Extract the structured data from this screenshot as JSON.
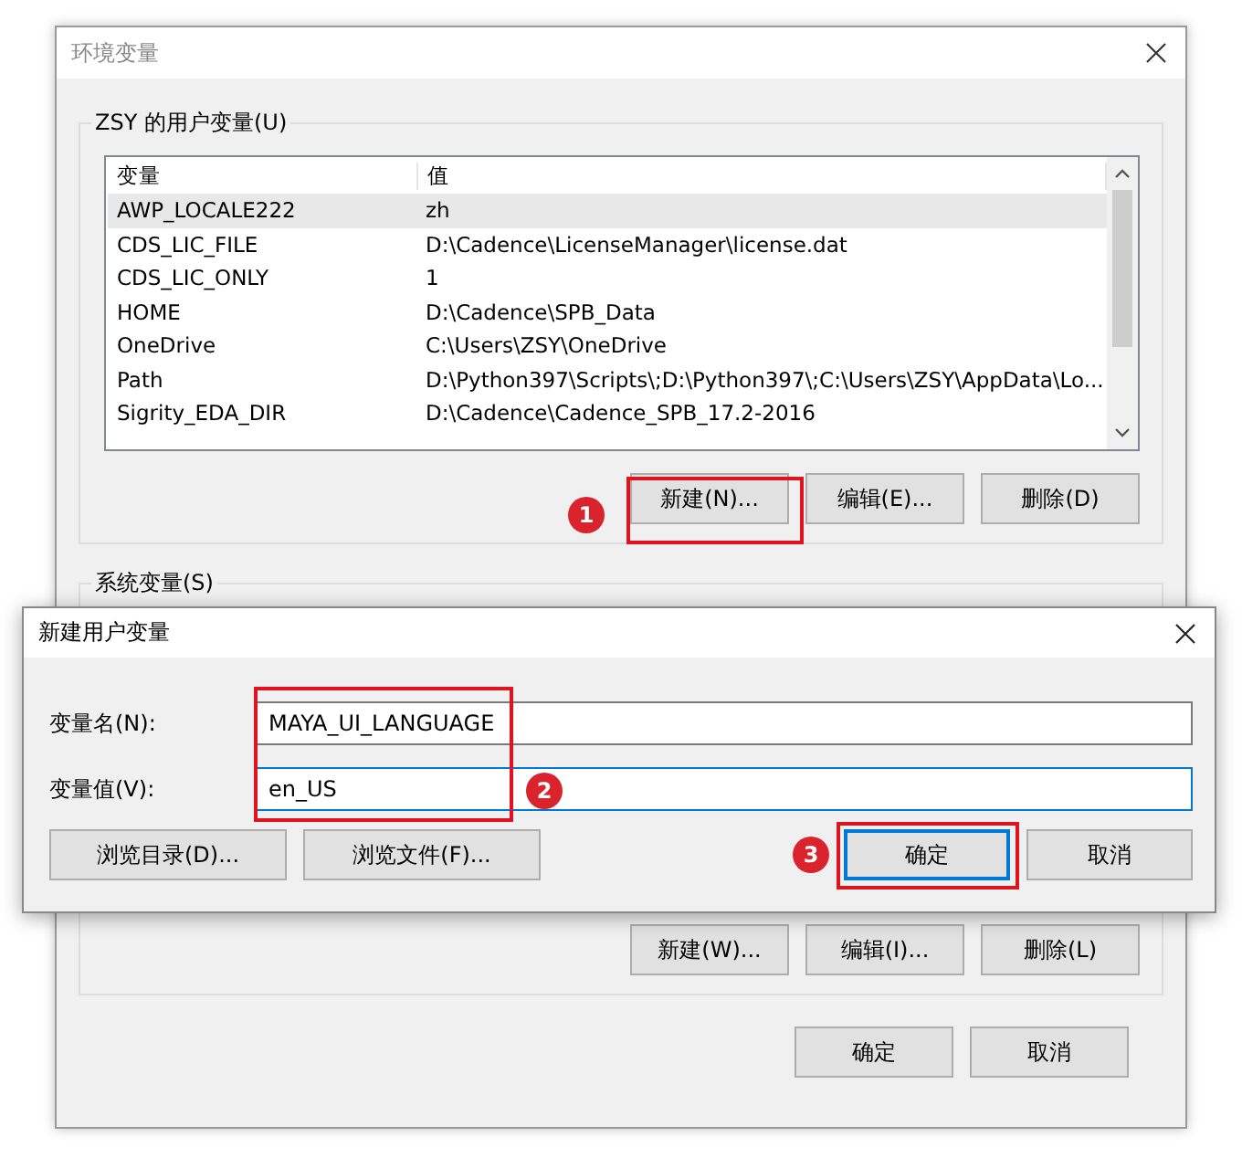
{
  "dialog": {
    "title": "环境变量"
  },
  "user_variables": {
    "label": "ZSY 的用户变量(U)",
    "columns": [
      "变量",
      "值"
    ],
    "rows": [
      {
        "name": "AWP_LOCALE222",
        "value": "zh",
        "selected": true
      },
      {
        "name": "CDS_LIC_FILE",
        "value": "D:\\Cadence\\LicenseManager\\license.dat",
        "selected": false
      },
      {
        "name": "CDS_LIC_ONLY",
        "value": "1",
        "selected": false
      },
      {
        "name": "HOME",
        "value": "D:\\Cadence\\SPB_Data",
        "selected": false
      },
      {
        "name": "OneDrive",
        "value": "C:\\Users\\ZSY\\OneDrive",
        "selected": false
      },
      {
        "name": "Path",
        "value": "D:\\Python397\\Scripts\\;D:\\Python397\\;C:\\Users\\ZSY\\AppData\\Lo...",
        "selected": false
      },
      {
        "name": "Sigrity_EDA_DIR",
        "value": "D:\\Cadence\\Cadence_SPB_17.2-2016",
        "selected": false
      }
    ],
    "buttons": [
      "新建(N)...",
      "编辑(E)...",
      "删除(D)"
    ]
  },
  "system_variables": {
    "label": "系统变量(S)",
    "buttons": [
      "新建(W)...",
      "编辑(I)...",
      "删除(L)"
    ]
  },
  "dialog_buttons": [
    "确定",
    "取消"
  ],
  "new_variable_dialog": {
    "title": "新建用户变量",
    "fields": [
      {
        "label": "变量名(N):",
        "value": "MAYA_UI_LANGUAGE",
        "focused": false
      },
      {
        "label": "变量值(V):",
        "value": "en_US",
        "focused": true
      }
    ],
    "buttons": [
      {
        "label": "浏览目录(D)...",
        "default": false
      },
      {
        "label": "浏览文件(F)...",
        "default": false
      },
      {
        "label": "确定",
        "default": true
      },
      {
        "label": "取消",
        "default": false
      }
    ]
  },
  "annotations": [
    {
      "number": "1"
    },
    {
      "number": "2"
    },
    {
      "number": "3"
    }
  ]
}
